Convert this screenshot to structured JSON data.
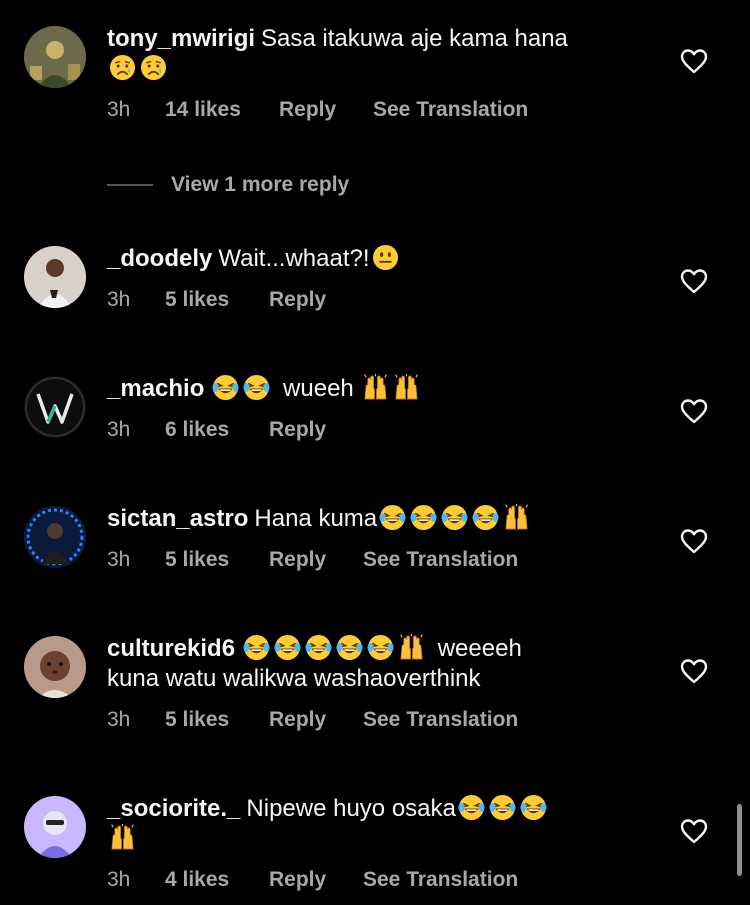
{
  "comments": [
    {
      "username": "tony_mwirigi",
      "text": "Sasa itakuwa aje kama hana",
      "emojis": [
        "crying-face-icon",
        "crying-face-icon"
      ],
      "time": "3h",
      "likes": "14 likes",
      "reply": "Reply",
      "translation": "See Translation"
    },
    {
      "username": "_doodely",
      "text": "Wait...whaat?!",
      "emojis": [
        "neutral-face-icon"
      ],
      "time": "3h",
      "likes": "5 likes",
      "reply": "Reply"
    },
    {
      "username": "_machio",
      "text_after": "wueeh",
      "emojis": [
        "laughing-face-icon",
        "laughing-face-icon",
        "raised-hands-icon",
        "raised-hands-icon"
      ],
      "time": "3h",
      "likes": "6 likes",
      "reply": "Reply"
    },
    {
      "username": "sictan_astro",
      "text": "Hana kuma",
      "emojis": [
        "laughing-face-icon",
        "laughing-face-icon",
        "laughing-face-icon",
        "laughing-face-icon",
        "raised-hands-icon"
      ],
      "time": "3h",
      "likes": "5 likes",
      "reply": "Reply",
      "translation": "See Translation"
    },
    {
      "username": "culturekid6",
      "text_after": "weeeeh",
      "text_line2": "kuna watu walikwa washaoverthink",
      "emojis": [
        "laughing-face-icon",
        "laughing-face-icon",
        "laughing-face-icon",
        "laughing-face-icon",
        "laughing-face-icon",
        "raised-hands-icon"
      ],
      "time": "3h",
      "likes": "5 likes",
      "reply": "Reply",
      "translation": "See Translation"
    },
    {
      "username": "_sociorite._",
      "text": "Nipewe huyo osaka",
      "emojis": [
        "laughing-face-icon",
        "laughing-face-icon",
        "laughing-face-icon",
        "raised-hands-icon"
      ],
      "time": "3h",
      "likes": "4 likes",
      "reply": "Reply",
      "translation": "See Translation"
    }
  ],
  "view_more": "View 1 more reply",
  "colors": {
    "background": "#000000",
    "text": "#f5f5f5",
    "meta": "#a8a8a8",
    "emoji_yellow": "#ffcc33"
  }
}
